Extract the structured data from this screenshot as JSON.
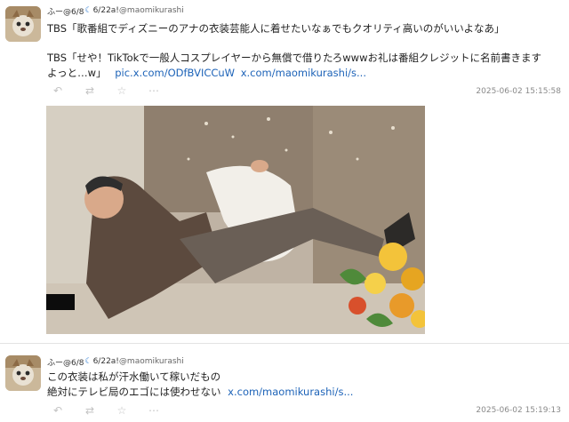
{
  "tweets": [
    {
      "display_name": "ふー@6/8",
      "moon_icon": "crescent-moon-icon",
      "display_name_suffix": "6/22a!",
      "handle": "@maomikurashi",
      "line1": "TBS「歌番組でディズニーのアナの衣装芸能人に着せたいなぁでもクオリティ高いのがいいよなあ」",
      "line2": "TBS「せや！TikTokで一般人コスプレイヤーから無償で借りたろwwwお礼は番組クレジットに名前書きます",
      "line3": "よっと…w」",
      "link1": "pic.x.com/ODfBVICCuW",
      "link2": "x.com/maomikurashi/s...",
      "timestamp": "2025-06-02 15:15:58"
    },
    {
      "display_name": "ふー@6/8",
      "moon_icon": "crescent-moon-icon",
      "display_name_suffix": "6/22a!",
      "handle": "@maomikurashi",
      "line1": "この衣装は私が汗水働いて稼いだもの",
      "line2": "絶対にテレビ局のエゴには使わせない",
      "link1": "x.com/maomikurashi/s...",
      "timestamp": "2025-06-02 15:19:13"
    }
  ],
  "icons": {
    "reply": "reply-icon",
    "retweet": "retweet-icon",
    "like": "like-icon",
    "more": "more-icon"
  },
  "colors": {
    "link": "#1d63b8",
    "timestamp": "#8a8a8a",
    "action_icon": "#c3c3c3"
  }
}
